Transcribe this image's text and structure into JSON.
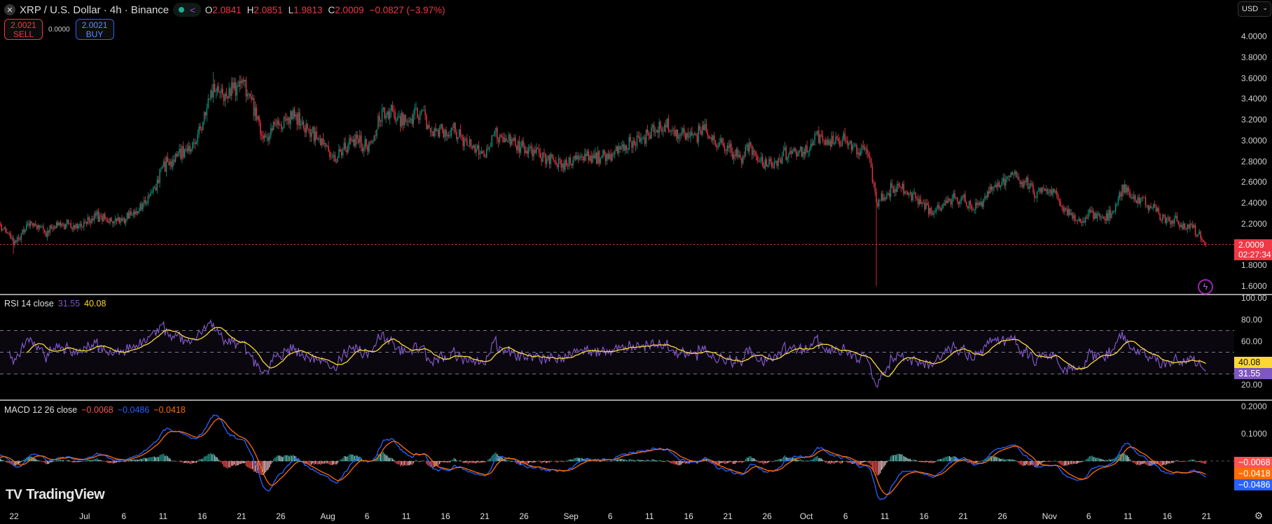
{
  "header": {
    "symbol_title": "XRP / U.S. Dollar · 4h · Binance",
    "symbol_icon": "xrp-logo-icon",
    "ohlc": {
      "o_label": "O",
      "o": "2.0841",
      "h_label": "H",
      "h": "2.0851",
      "l_label": "L",
      "l": "1.9813",
      "c_label": "C",
      "c": "2.0009",
      "change": "−0.0827 (−3.97%)"
    }
  },
  "trade": {
    "sell_price": "2.0021",
    "sell_label": "SELL",
    "spread": "0.0000",
    "buy_price": "2.0021",
    "buy_label": "BUY"
  },
  "currency": {
    "selected": "USD"
  },
  "price_axis": {
    "ticks": [
      "4.0000",
      "3.8000",
      "3.6000",
      "3.4000",
      "3.2000",
      "3.0000",
      "2.8000",
      "2.6000",
      "2.4000",
      "2.2000",
      "1.8000",
      "1.6000"
    ],
    "last_price": "2.0009",
    "countdown": "02:27:34"
  },
  "rsi": {
    "legend_name": "RSI 14 close",
    "rsi_value": "31.55",
    "ma_value": "40.08",
    "ticks": [
      "100.00",
      "80.00",
      "60.00",
      "20.00"
    ]
  },
  "macd": {
    "legend_name": "MACD 12 26 close",
    "hist_value": "−0.0068",
    "macd_value": "−0.0486",
    "signal_value": "−0.0418",
    "ticks": [
      "0.2000",
      "0.1000"
    ]
  },
  "branding": {
    "logo_text": "TradingView"
  },
  "time_axis": {
    "ticks": [
      {
        "label": "22",
        "day": 2
      },
      {
        "label": "Jul",
        "day": 11
      },
      {
        "label": "6",
        "day": 16
      },
      {
        "label": "11",
        "day": 21
      },
      {
        "label": "16",
        "day": 26
      },
      {
        "label": "21",
        "day": 31
      },
      {
        "label": "26",
        "day": 36
      },
      {
        "label": "Aug",
        "day": 42
      },
      {
        "label": "6",
        "day": 47
      },
      {
        "label": "11",
        "day": 52
      },
      {
        "label": "16",
        "day": 57
      },
      {
        "label": "21",
        "day": 62
      },
      {
        "label": "26",
        "day": 67
      },
      {
        "label": "Sep",
        "day": 73
      },
      {
        "label": "6",
        "day": 78
      },
      {
        "label": "11",
        "day": 83
      },
      {
        "label": "16",
        "day": 88
      },
      {
        "label": "21",
        "day": 93
      },
      {
        "label": "26",
        "day": 98
      },
      {
        "label": "Oct",
        "day": 103
      },
      {
        "label": "6",
        "day": 108
      },
      {
        "label": "11",
        "day": 113
      },
      {
        "label": "16",
        "day": 118
      },
      {
        "label": "21",
        "day": 123
      },
      {
        "label": "26",
        "day": 128
      },
      {
        "label": "Nov",
        "day": 134
      },
      {
        "label": "6",
        "day": 139
      },
      {
        "label": "11",
        "day": 144
      },
      {
        "label": "16",
        "day": 149
      },
      {
        "label": "21",
        "day": 154
      }
    ]
  },
  "colors": {
    "up": "#089981",
    "down": "#f23645",
    "rsi": "#7e57c2",
    "rsi_ma": "#fdd835",
    "macd": "#2962ff",
    "signal": "#ff6d00"
  },
  "chart_data": {
    "type": "candlestick",
    "title": "XRP / U.S. Dollar · 4h · Binance",
    "interval": "4h",
    "start_date": "Jun 20",
    "candles_per_day": 6,
    "ylim": [
      1.55,
      4.05
    ],
    "daily_closes": [
      2.15,
      2.12,
      2.0,
      2.1,
      2.18,
      2.15,
      2.12,
      2.15,
      2.18,
      2.2,
      2.2,
      2.22,
      2.25,
      2.28,
      2.22,
      2.25,
      2.25,
      2.28,
      2.32,
      2.4,
      2.55,
      2.75,
      2.8,
      2.88,
      2.92,
      2.98,
      3.1,
      3.4,
      3.52,
      3.45,
      3.5,
      3.55,
      3.45,
      3.2,
      3.05,
      3.1,
      3.15,
      3.22,
      3.25,
      3.12,
      3.08,
      3.02,
      2.95,
      2.8,
      2.92,
      3.0,
      2.98,
      2.95,
      3.05,
      3.3,
      3.28,
      3.22,
      3.18,
      3.25,
      3.28,
      3.12,
      3.1,
      3.1,
      3.12,
      3.05,
      2.95,
      2.92,
      2.85,
      3.05,
      3.05,
      3.0,
      2.95,
      2.95,
      2.92,
      2.88,
      2.82,
      2.8,
      2.78,
      2.78,
      2.82,
      2.85,
      2.83,
      2.85,
      2.87,
      2.88,
      2.95,
      3.0,
      3.02,
      3.05,
      3.1,
      3.15,
      3.1,
      3.05,
      3.03,
      3.05,
      3.1,
      3.0,
      2.98,
      2.95,
      2.85,
      2.85,
      2.95,
      2.8,
      2.75,
      2.8,
      2.85,
      2.9,
      2.88,
      2.95,
      3.0,
      3.05,
      3.0,
      3.02,
      3.0,
      2.95,
      2.9,
      2.85,
      2.4,
      2.45,
      2.55,
      2.55,
      2.48,
      2.45,
      2.4,
      2.3,
      2.35,
      2.4,
      2.45,
      2.45,
      2.38,
      2.4,
      2.45,
      2.55,
      2.6,
      2.65,
      2.65,
      2.6,
      2.5,
      2.5,
      2.5,
      2.48,
      2.35,
      2.25,
      2.22,
      2.3,
      2.25,
      2.25,
      2.3,
      2.5,
      2.55,
      2.42,
      2.45,
      2.35,
      2.3,
      2.25,
      2.25,
      2.15,
      2.2,
      2.1,
      2.0009
    ],
    "notable_lows": [
      {
        "day_index": 112,
        "low": 1.6
      },
      {
        "day_index": 2,
        "low": 1.91
      },
      {
        "day_index": 28,
        "high": 3.66
      }
    ],
    "last_price": 2.0009,
    "indicators": {
      "rsi": {
        "period": 14,
        "ma": 14,
        "bands": [
          30,
          50,
          70
        ],
        "ylim": [
          0,
          100
        ]
      },
      "macd": {
        "fast": 12,
        "slow": 26,
        "signal": 9
      }
    }
  }
}
